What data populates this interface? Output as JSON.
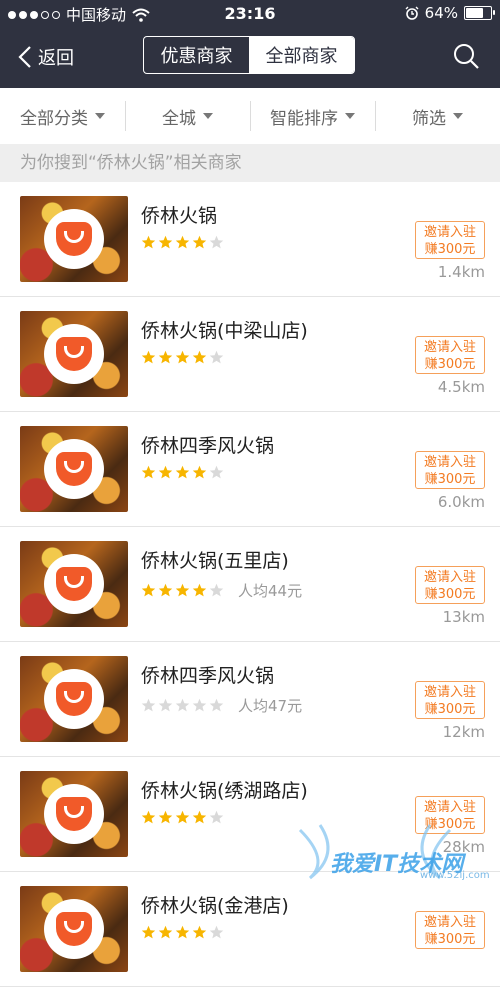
{
  "status_bar": {
    "carrier": "中国移动",
    "time": "23:16",
    "battery": "64%",
    "battery_level": 0.64,
    "signal_dots": [
      true,
      true,
      true,
      false,
      false
    ]
  },
  "nav": {
    "back_label": "返回",
    "tabs": [
      {
        "label": "优惠商家",
        "active": false
      },
      {
        "label": "全部商家",
        "active": true
      }
    ],
    "search_icon": "search-icon"
  },
  "filters": [
    {
      "label": "全部分类"
    },
    {
      "label": "全城"
    },
    {
      "label": "智能排序"
    },
    {
      "label": "筛选"
    }
  ],
  "hint": "为你搜到“侨林火锅”相关商家",
  "merchants": [
    {
      "name": "侨林火锅",
      "stars": 4,
      "avg_price": "",
      "invite": [
        "邀请入驻",
        "赚300元"
      ],
      "distance": "1.4km"
    },
    {
      "name": "侨林火锅(中梁山店)",
      "stars": 4,
      "avg_price": "",
      "invite": [
        "邀请入驻",
        "赚300元"
      ],
      "distance": "4.5km"
    },
    {
      "name": "侨林四季风火锅",
      "stars": 4,
      "avg_price": "",
      "invite": [
        "邀请入驻",
        "赚300元"
      ],
      "distance": "6.0km"
    },
    {
      "name": "侨林火锅(五里店)",
      "stars": 4,
      "avg_price": "人均44元",
      "invite": [
        "邀请入驻",
        "赚300元"
      ],
      "distance": "13km"
    },
    {
      "name": "侨林四季风火锅",
      "stars": 0,
      "avg_price": "人均47元",
      "invite": [
        "邀请入驻",
        "赚300元"
      ],
      "distance": "12km"
    },
    {
      "name": "侨林火锅(绣湖路店)",
      "stars": 4,
      "avg_price": "",
      "invite": [
        "邀请入驻",
        "赚300元"
      ],
      "distance": "28km"
    },
    {
      "name": "侨林火锅(金港店)",
      "stars": 4,
      "avg_price": "",
      "invite": [
        "邀请入驻",
        "赚300元"
      ],
      "distance": ""
    }
  ],
  "watermark": {
    "text": "我爱IT技术网",
    "sub": "www.52ij.com"
  },
  "colors": {
    "topbar": "#2f3240",
    "accent": "#f37b22",
    "star_on": "#f7b500",
    "star_off": "#d9d9d9"
  }
}
